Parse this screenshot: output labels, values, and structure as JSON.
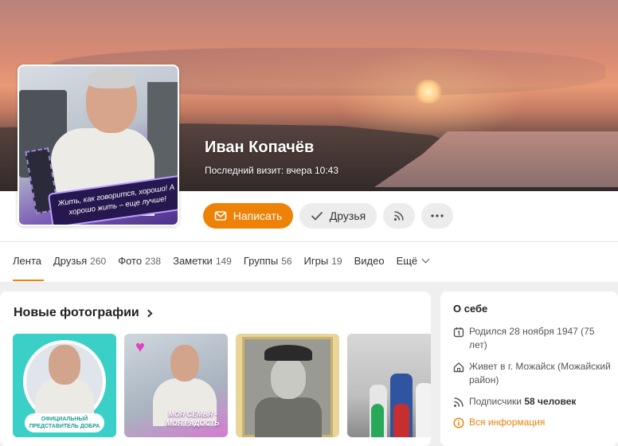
{
  "profile": {
    "name": "Иван Копачёв",
    "last_visit": "Последний визит: вчера 10:43",
    "avatar_banner": "Жить, как говорится, хорошо! А хорошо жить – еще лучше!"
  },
  "actions": {
    "write_label": "Написать",
    "friends_label": "Друзья",
    "subscribe_icon": "rss-icon",
    "more_icon": "more-dots-icon"
  },
  "tabs": [
    {
      "label": "Лента",
      "count": ""
    },
    {
      "label": "Друзья",
      "count": "260"
    },
    {
      "label": "Фото",
      "count": "238"
    },
    {
      "label": "Заметки",
      "count": "149"
    },
    {
      "label": "Группы",
      "count": "56"
    },
    {
      "label": "Игры",
      "count": "19"
    },
    {
      "label": "Видео",
      "count": ""
    },
    {
      "label": "Ещё",
      "count": ""
    }
  ],
  "photos": {
    "title": "Новые фотографии",
    "thumb1_label": "ОФИЦИАЛЬНЫЙ ПРЕДСТАВИТЕЛЬ ДОБРА",
    "thumb2_label": "МОЯ СЕМЬЯ - МОЯ РАДОСТЬ"
  },
  "about": {
    "title": "О себе",
    "born": "Родился 28 ноября 1947 (75 лет)",
    "lives": "Живет в г. Можайск (Можайский район)",
    "subscribers_prefix": "Подписчики",
    "subscribers_value": "58 человек",
    "more_info": "Вся информация"
  },
  "colors": {
    "accent": "#ee8208",
    "button_gray": "#ececec",
    "page_bg": "#efefef"
  }
}
